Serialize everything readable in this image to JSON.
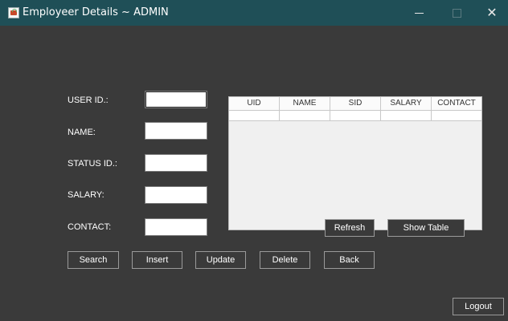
{
  "window": {
    "title": "Employeer Details ~ ADMIN",
    "close_glyph": "✕"
  },
  "form": {
    "user_id_label": "USER ID.:",
    "name_label": "NAME:",
    "status_id_label": "STATUS ID.:",
    "salary_label": "SALARY:",
    "contact_label": "CONTACT:",
    "user_id_value": "",
    "name_value": "",
    "status_id_value": "",
    "salary_value": "",
    "contact_value": ""
  },
  "table": {
    "columns": [
      "UID",
      "NAME",
      "SID",
      "SALARY",
      "CONTACT"
    ],
    "rows": [
      [
        "",
        "",
        "",
        "",
        ""
      ]
    ]
  },
  "buttons": {
    "refresh": "Refresh",
    "show_table": "Show Table",
    "search": "Search",
    "insert": "Insert",
    "update": "Update",
    "delete": "Delete",
    "back": "Back",
    "logout": "Logout"
  },
  "colors": {
    "titlebar": "#1f4f57",
    "background": "#3a3a3a",
    "text": "#ffffff"
  }
}
